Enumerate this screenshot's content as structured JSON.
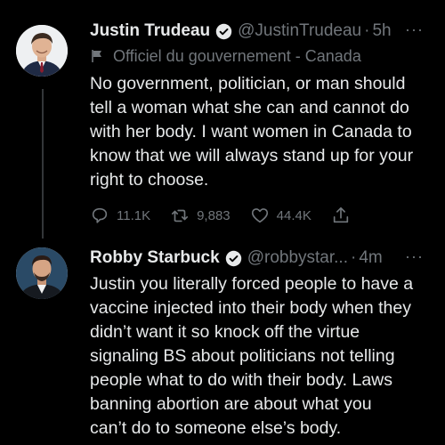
{
  "tweets": [
    {
      "name": "Justin Trudeau",
      "handle": "@JustinTrudeau",
      "separator": "·",
      "time": "5h",
      "label": "Officiel du gouvernement - Canada",
      "text": "No government, politician, or man should\ntell a woman what she can and cannot do\nwith her body. I want women in Canada to\nknow that we will always stand up for your\nright to choose.",
      "replies": "11.1K",
      "retweets": "9,883",
      "likes": "44.4K",
      "avatar": "avatar-photo-trudeau",
      "verified_icon": "verified-badge-icon"
    },
    {
      "name": "Robby Starbuck",
      "handle": "@robbystar...",
      "separator": "·",
      "time": "4m",
      "text": "Justin you literally forced people to have a\nvaccine injected into their body when they\ndidn’t want it so knock off the virtue\nsignaling BS about politicians not telling\npeople what to do with their body. Laws\nbanning abortion are about what you\ncan’t do to someone else’s body.",
      "avatar": "avatar-photo-starbuck",
      "verified_icon": "verified-badge-icon"
    }
  ],
  "more_label": "···",
  "colors": {
    "background": "#000000",
    "text": "#e7e9ea",
    "muted": "#71767b",
    "thread_line": "#333639"
  }
}
